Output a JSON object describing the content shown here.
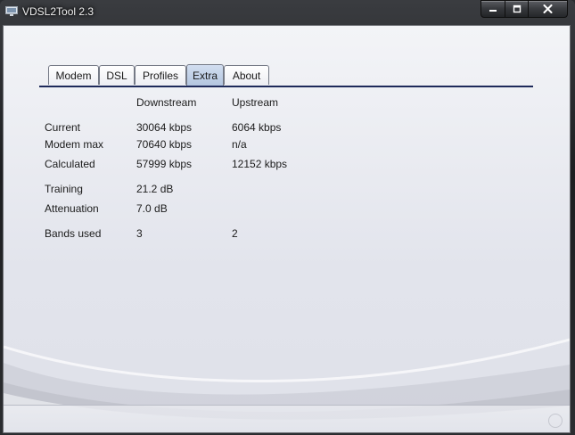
{
  "window": {
    "title": "VDSL2Tool 2.3",
    "controls": {
      "minimize": "minimize",
      "maximize": "maximize",
      "close": "close"
    }
  },
  "tabs": [
    {
      "label": "Modem",
      "active": false
    },
    {
      "label": "DSL",
      "active": false
    },
    {
      "label": "Profiles",
      "active": false
    },
    {
      "label": "Extra",
      "active": true
    },
    {
      "label": "About",
      "active": false
    }
  ],
  "table": {
    "headers": {
      "downstream": "Downstream",
      "upstream": "Upstream"
    },
    "rows": [
      {
        "label": "Current",
        "downstream": "30064 kbps",
        "upstream": "6064 kbps"
      },
      {
        "label": "Modem max",
        "downstream": "70640 kbps",
        "upstream": "n/a"
      },
      {
        "label": "Calculated",
        "downstream": "57999 kbps",
        "upstream": "12152 kbps"
      },
      {
        "label": "Training",
        "downstream": "21.2 dB",
        "upstream": ""
      },
      {
        "label": "Attenuation",
        "downstream": "7.0 dB",
        "upstream": ""
      },
      {
        "label": "Bands used",
        "downstream": "3",
        "upstream": "2"
      }
    ]
  },
  "colors": {
    "tab_line": "#1e2a5a",
    "active_tab": "#b3c5df",
    "close_glyph": "#ffffff"
  }
}
